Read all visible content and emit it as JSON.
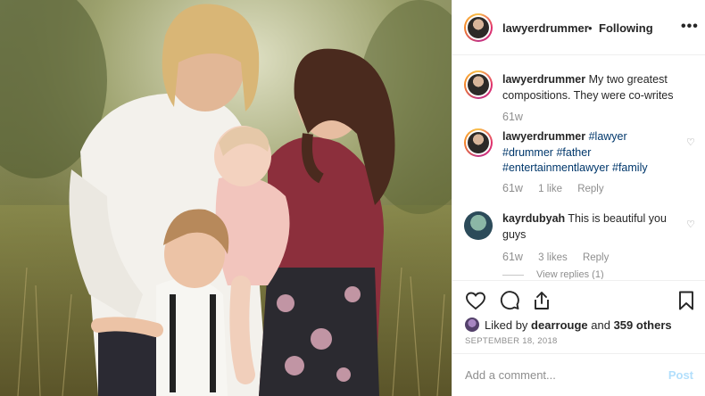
{
  "header": {
    "username": "lawyerdrummer",
    "separator": "•",
    "follow_state": "Following",
    "more_icon": "more-options-icon",
    "more_glyph": "•••"
  },
  "comments": [
    {
      "username": "lawyerdrummer",
      "text": "My two greatest compositions. They were co-writes",
      "age": "61w",
      "likes": "",
      "reply": ""
    },
    {
      "username": "lawyerdrummer",
      "tags": [
        "#lawyer",
        "#drummer",
        "#father",
        "#entertainmentlawyer",
        "#family"
      ],
      "age": "61w",
      "likes": "1 like",
      "reply": "Reply"
    },
    {
      "username": "kayrdubyah",
      "text": "This is beautiful you guys",
      "age": "61w",
      "likes": "3 likes",
      "reply": "Reply",
      "view_replies": "View replies (1)"
    }
  ],
  "actions": {
    "like_icon": "heart-icon",
    "comment_icon": "comment-icon",
    "share_icon": "share-icon",
    "save_icon": "bookmark-icon"
  },
  "likes": {
    "prefix": "Liked by",
    "user": "dearrouge",
    "joiner": "and",
    "others": "359 others"
  },
  "date": "SEPTEMBER 18, 2018",
  "add_comment": {
    "placeholder": "Add a comment...",
    "post_label": "Post"
  },
  "colors": {
    "link": "#00376b",
    "muted": "#8e8e8e",
    "post_disabled": "#b2dffc"
  }
}
